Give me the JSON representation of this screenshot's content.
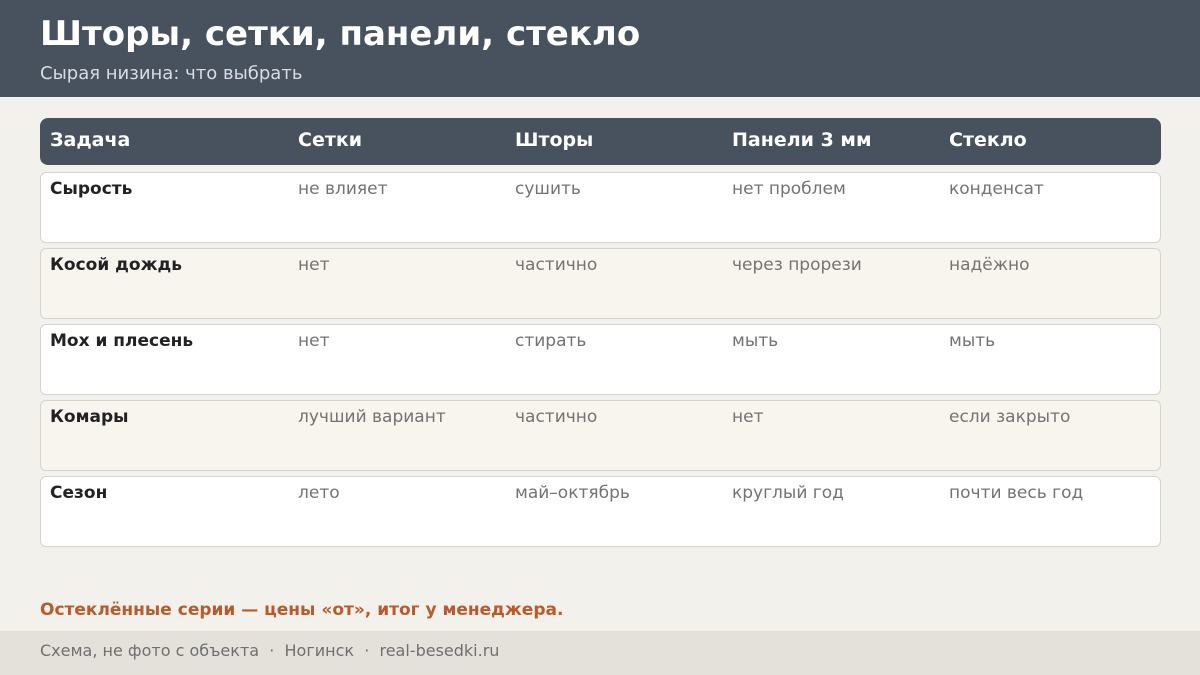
{
  "header": {
    "title": "Шторы, сетки, панели, стекло",
    "subtitle": "Сырая низина: что выбрать"
  },
  "table": {
    "columns": [
      "Задача",
      "Сетки",
      "Шторы",
      "Панели 3 мм",
      "Стекло"
    ],
    "rows": [
      [
        "Сырость",
        "не влияет",
        "сушить",
        "нет проблем",
        "конденсат"
      ],
      [
        "Косой дождь",
        "нет",
        "частично",
        "через прорези",
        "надёжно"
      ],
      [
        "Мох и плесень",
        "нет",
        "стирать",
        "мыть",
        "мыть"
      ],
      [
        "Комары",
        "лучший вариант",
        "частично",
        "нет",
        "если закрыто"
      ],
      [
        "Сезон",
        "лето",
        "май–октябрь",
        "круглый год",
        "почти весь год"
      ]
    ]
  },
  "note": "Остеклённые серии — цены «от», итог у менеджера.",
  "footer": {
    "text": "Схема, не фото с объекта  ·  Ногинск  ·  real-besedki.ru"
  },
  "colors": {
    "header_bg": "#48515e",
    "page_bg": "#f3f1ec",
    "accent": "#b85a2b",
    "row_alt_bg": "#f8f5ee"
  }
}
